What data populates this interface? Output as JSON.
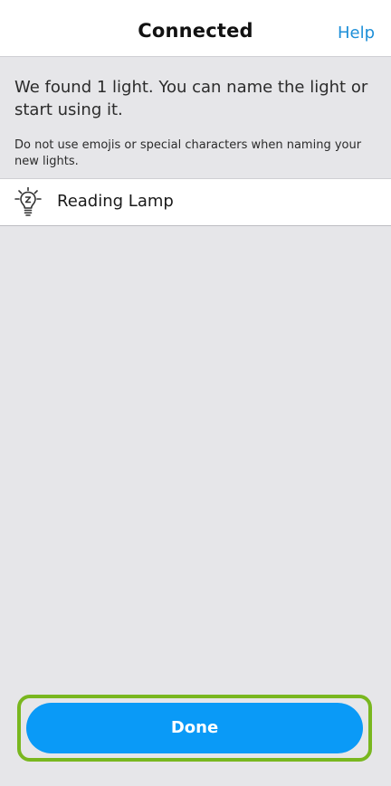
{
  "header": {
    "title": "Connected",
    "help_label": "Help"
  },
  "content": {
    "message": "We found 1 light. You can name the light or start using it.",
    "warning": "Do not use emojis or special characters when naming your new lights."
  },
  "lights": [
    {
      "name": "Reading Lamp",
      "icon": "lightbulb-icon"
    }
  ],
  "footer": {
    "done_label": "Done"
  },
  "colors": {
    "accent": "#0a9af7",
    "link": "#1d8fd8",
    "highlight": "#79b71f",
    "background": "#e6e6e9"
  }
}
